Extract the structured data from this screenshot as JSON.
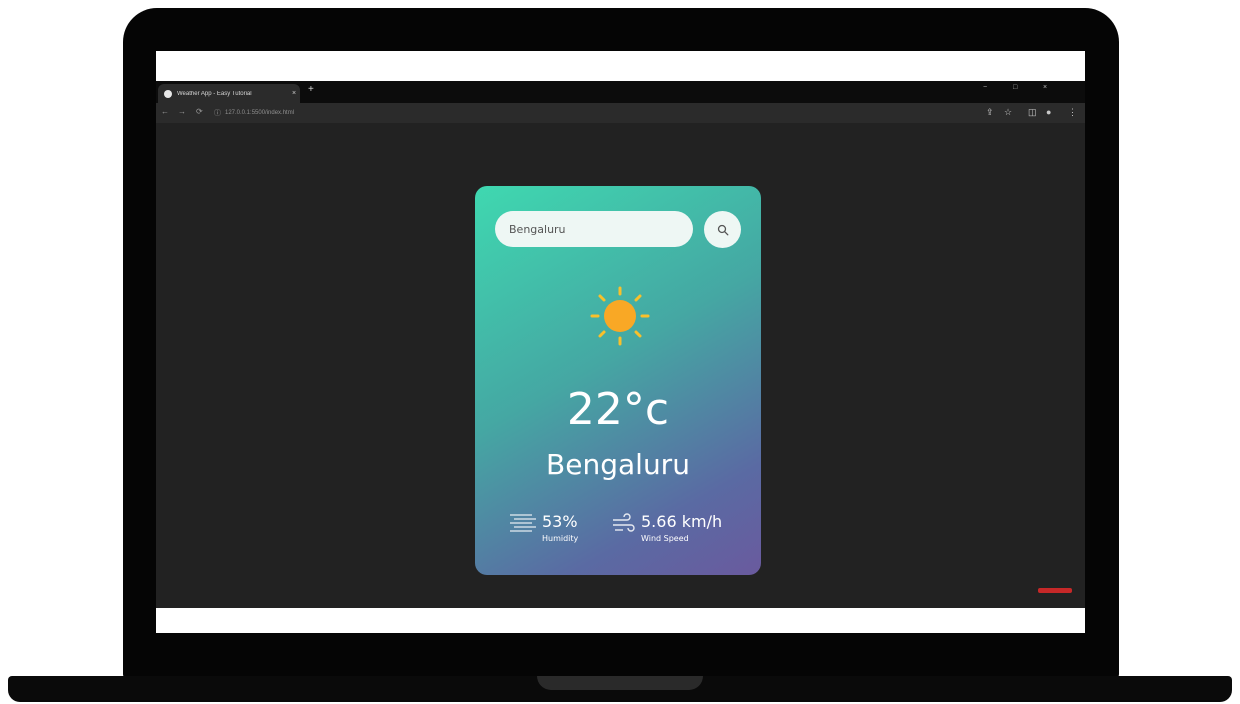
{
  "browser": {
    "tab_title": "Weather App - Easy Tutorial",
    "tab_close": "×",
    "new_tab": "+",
    "window_controls": [
      "−",
      "□",
      "×"
    ],
    "address": "127.0.0.1:5500/index.html"
  },
  "weather": {
    "search_value": "Bengaluru",
    "temperature": "22°c",
    "city": "Bengaluru",
    "humidity_value": "53%",
    "humidity_label": "Humidity",
    "wind_value": "5.66 km/h",
    "wind_label": "Wind Speed",
    "condition_icon": "sun-icon"
  },
  "colors": {
    "card_top": "#3fd8b0",
    "card_bottom": "#6a5a9e",
    "sun": "#f9a825",
    "page_bg": "#222222"
  }
}
